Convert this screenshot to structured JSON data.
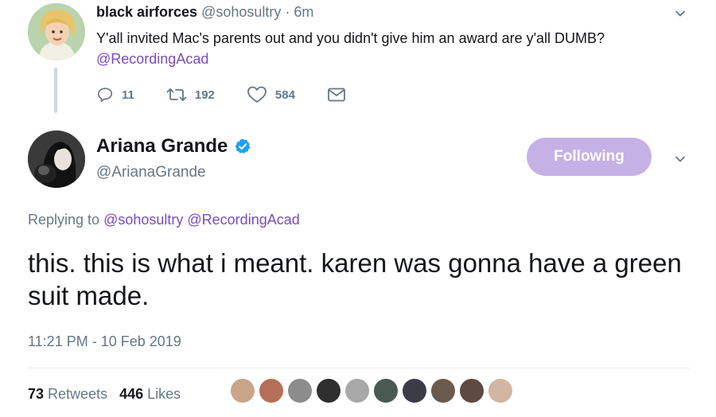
{
  "parent_tweet": {
    "name": "black airforces",
    "handle": "@sohosultry",
    "separator": " · ",
    "time": "6m",
    "text_before": "Y'all invited Mac's parents out and you didn't give him an award are y'all DUMB? ",
    "mention": "@RecordingAcad",
    "actions": {
      "replies": "11",
      "retweets": "192",
      "likes": "584"
    },
    "icons": [
      "reply-icon",
      "retweet-icon",
      "like-icon",
      "message-icon"
    ]
  },
  "main_tweet": {
    "name": "Ariana Grande",
    "handle": "@ArianaGrande",
    "follow_label": "Following",
    "replying_prefix": "Replying to ",
    "replying_to_1": "@sohosultry",
    "replying_to_2": "@RecordingAcad",
    "text": "this. this is what i meant. karen was gonna have a green suit made.",
    "timestamp": "11:21 PM - 10 Feb 2019",
    "retweet_count": "73",
    "retweet_label": " Retweets",
    "like_count": "446",
    "like_label": " Likes"
  },
  "colors": {
    "accent": "#794bc4",
    "follow_button": "#c5b1e6",
    "secondary_text": "#657786",
    "verified": "#1da1f2"
  }
}
